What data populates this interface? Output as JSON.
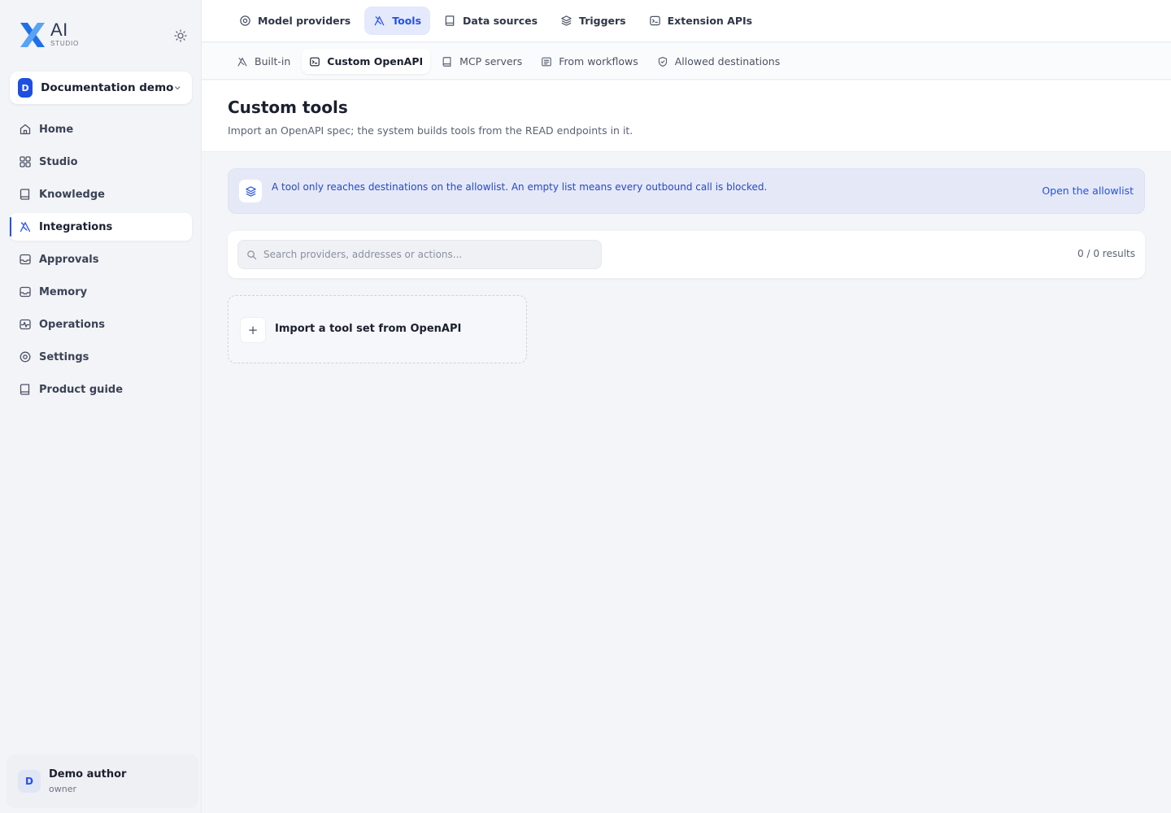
{
  "brand": {
    "name": "AI",
    "tagline": "STUDIO"
  },
  "workspace": {
    "initial": "D",
    "name": "Documentation demo"
  },
  "sidebar": {
    "items": [
      {
        "label": "Home",
        "icon": "home-icon"
      },
      {
        "label": "Studio",
        "icon": "grid-icon"
      },
      {
        "label": "Knowledge",
        "icon": "book-icon"
      },
      {
        "label": "Integrations",
        "icon": "tools-icon",
        "active": true
      },
      {
        "label": "Approvals",
        "icon": "inbox-icon"
      },
      {
        "label": "Memory",
        "icon": "inbox-icon"
      },
      {
        "label": "Operations",
        "icon": "activity-icon"
      },
      {
        "label": "Settings",
        "icon": "gear-icon"
      },
      {
        "label": "Product guide",
        "icon": "book-icon"
      }
    ]
  },
  "user": {
    "initial": "D",
    "name": "Demo author",
    "role": "owner"
  },
  "top_tabs": [
    {
      "label": "Model providers",
      "icon": "provider-icon"
    },
    {
      "label": "Tools",
      "icon": "tools-icon",
      "active": true
    },
    {
      "label": "Data sources",
      "icon": "book-icon"
    },
    {
      "label": "Triggers",
      "icon": "layers-icon"
    },
    {
      "label": "Extension APIs",
      "icon": "terminal-icon"
    }
  ],
  "sub_tabs": [
    {
      "label": "Built-in",
      "icon": "tools-icon"
    },
    {
      "label": "Custom OpenAPI",
      "icon": "terminal-icon",
      "active": true
    },
    {
      "label": "MCP servers",
      "icon": "book-icon"
    },
    {
      "label": "From workflows",
      "icon": "list-icon"
    },
    {
      "label": "Allowed destinations",
      "icon": "shield-icon"
    }
  ],
  "page": {
    "title": "Custom tools",
    "subtitle": "Import an OpenAPI spec; the system builds tools from the READ endpoints in it."
  },
  "notice": {
    "text": "A tool only reaches destinations on the allowlist. An empty list means every outbound call is blocked.",
    "link": "Open the allowlist"
  },
  "search": {
    "placeholder": "Search providers, addresses or actions...",
    "value": "",
    "results": "0 / 0 results"
  },
  "import_card": {
    "label": "Import a tool set from OpenAPI",
    "plus": "+"
  },
  "colors": {
    "accent": "#2451e6",
    "logo_blue": "#1f6fe8",
    "notice_bg": "#e5e9f7",
    "sidebar_bg": "#f3f4f7"
  }
}
